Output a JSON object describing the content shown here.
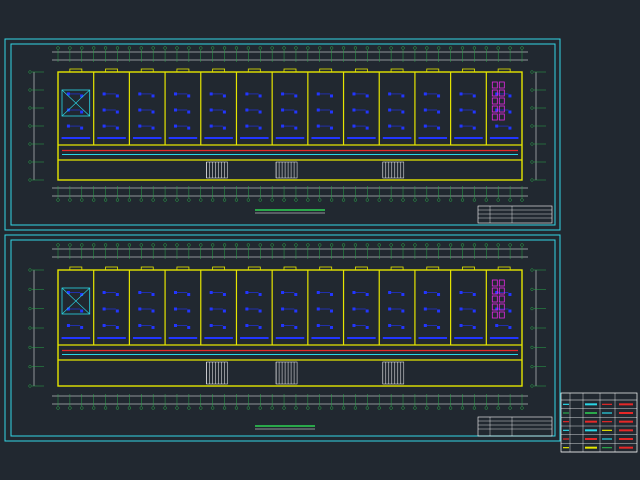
{
  "colors": {
    "background": "#212830",
    "frame": "#33d6e6",
    "wall": "#e6e600",
    "grid_line": "#2aa84a",
    "dimension": "#ffffff",
    "device": "#2236ff",
    "pipe_red": "#e62828",
    "pipe_cyan": "#2ad6e6",
    "pipe_magenta": "#e628e6",
    "text": "#e8e8e8"
  },
  "drawing": {
    "sheets": [
      {
        "plan": {
          "cols": 13,
          "has_legend": false
        }
      },
      {
        "plan": {
          "cols": 13,
          "has_legend": true
        }
      }
    ]
  },
  "legend": {
    "row_count": 6,
    "row_colors": [
      "#2ad6e6",
      "#2aa84a",
      "#e62828",
      "#2ad6e6",
      "#e62828",
      "#e6e600"
    ]
  }
}
